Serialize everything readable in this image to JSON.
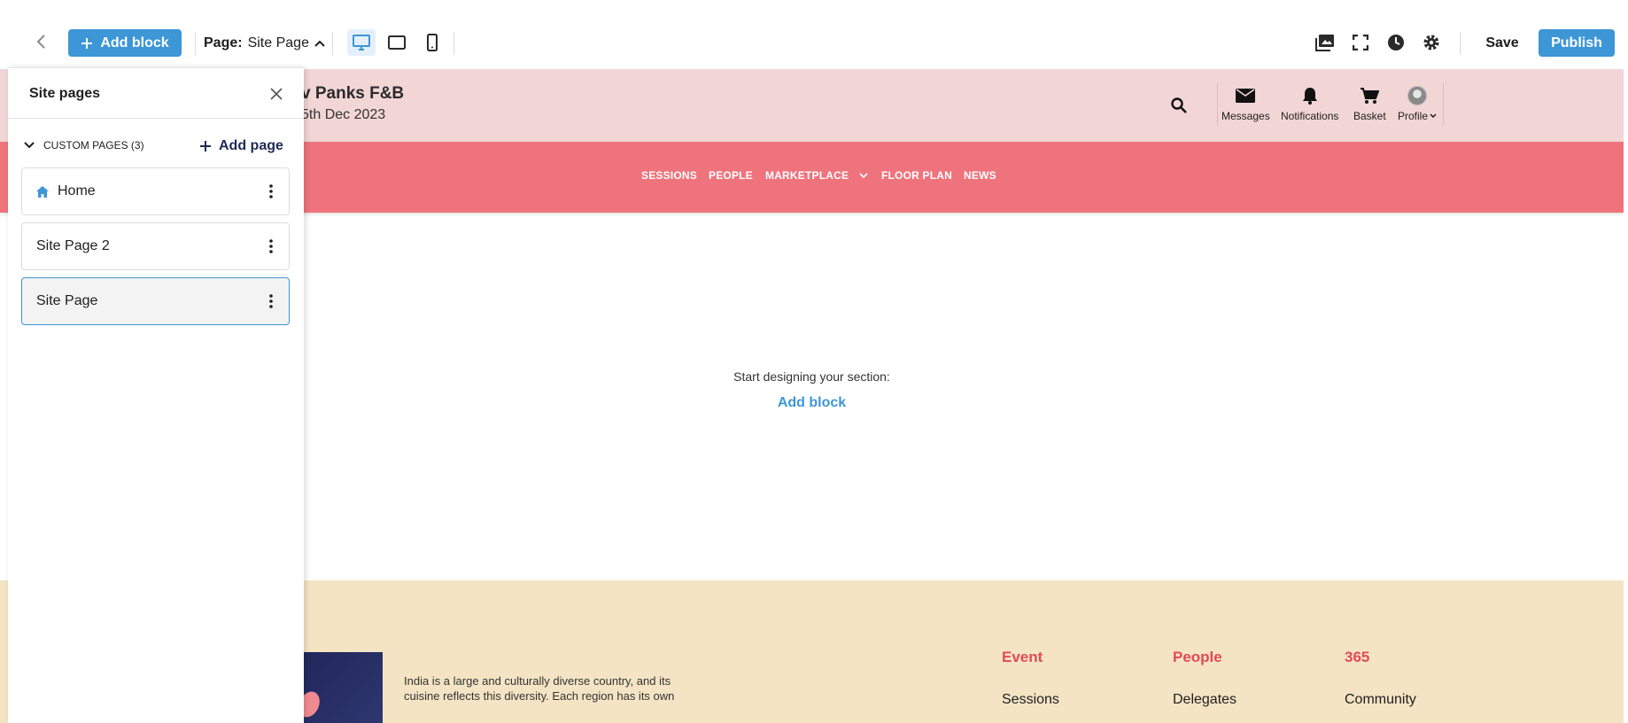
{
  "toolbar": {
    "add_block_label": "Add block",
    "page_label": "Page:",
    "page_value": "Site Page",
    "save_label": "Save",
    "publish_label": "Publish",
    "accent_color": "#3d96d6"
  },
  "panel": {
    "title": "Site pages",
    "section_label": "CUSTOM PAGES (3)",
    "add_page_label": "Add page",
    "pages": [
      {
        "name": "Home",
        "icon": "home-icon"
      },
      {
        "name": "Site Page 2"
      },
      {
        "name": "Site Page",
        "selected": true
      }
    ]
  },
  "site": {
    "title": "v Panks F&B",
    "date": "5th Dec 2023",
    "header_items": {
      "messages": "Messages",
      "notifications": "Notifications",
      "basket": "Basket",
      "profile": "Profile"
    },
    "nav": {
      "sessions": "SESSIONS",
      "people": "PEOPLE",
      "marketplace": "MARKETPLACE",
      "floor_plan": "FLOOR PLAN",
      "news": "NEWS"
    },
    "empty_text": "Start designing your section:",
    "empty_link": "Add block",
    "footer": {
      "description": "India is a large and culturally diverse country, and its cuisine reflects this diversity. Each region has its own",
      "col1_heading": "Event",
      "col1_link": "Sessions",
      "col2_heading": "People",
      "col2_link": "Delegates",
      "col3_heading": "365",
      "col3_link": "Community"
    },
    "colors": {
      "header_bg": "#f2d5d5",
      "nav_bg": "#ef737d",
      "footer_bg": "#f4e4c4",
      "footer_heading": "#e14b56"
    }
  }
}
